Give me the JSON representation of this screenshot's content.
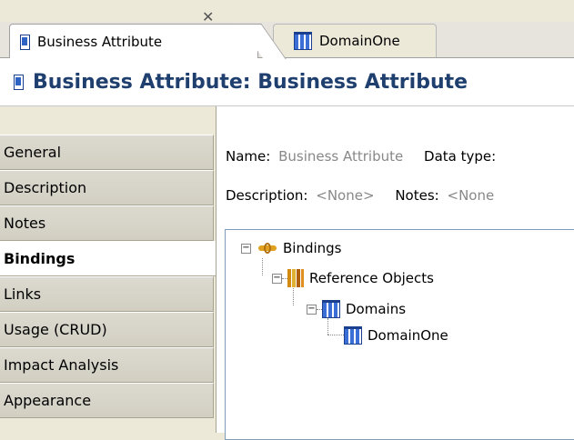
{
  "tabs": [
    {
      "label": "Business Attribute",
      "icon": "business-attribute-icon",
      "active": true
    },
    {
      "label": "DomainOne",
      "icon": "domain-icon",
      "active": false
    }
  ],
  "header": {
    "title": "Business Attribute: Business Attribute",
    "icon": "business-attribute-icon"
  },
  "sidebar": {
    "items": [
      {
        "label": "General"
      },
      {
        "label": "Description"
      },
      {
        "label": "Notes"
      },
      {
        "label": "Bindings",
        "selected": true
      },
      {
        "label": "Links"
      },
      {
        "label": "Usage (CRUD)"
      },
      {
        "label": "Impact Analysis"
      },
      {
        "label": "Appearance"
      }
    ]
  },
  "fields": {
    "name_label": "Name:",
    "name_value": "Business Attribute",
    "datatype_label": "Data type:",
    "description_label": "Description:",
    "description_value": "<None>",
    "notes_label": "Notes:",
    "notes_value": "<None"
  },
  "tree": {
    "root": {
      "label": "Bindings",
      "expanded": true,
      "icon": "binding-icon"
    },
    "reference_objects": {
      "label": "Reference Objects",
      "expanded": true,
      "icon": "books-icon"
    },
    "domains": {
      "label": "Domains",
      "expanded": true,
      "icon": "domain-icon"
    },
    "domain_one": {
      "label": "DomainOne",
      "icon": "domain-icon"
    }
  },
  "colors": {
    "title": "#1f3f6f",
    "accent": "#2e62c5",
    "panel_bg": "#ece9d8",
    "muted_text": "#888888"
  }
}
